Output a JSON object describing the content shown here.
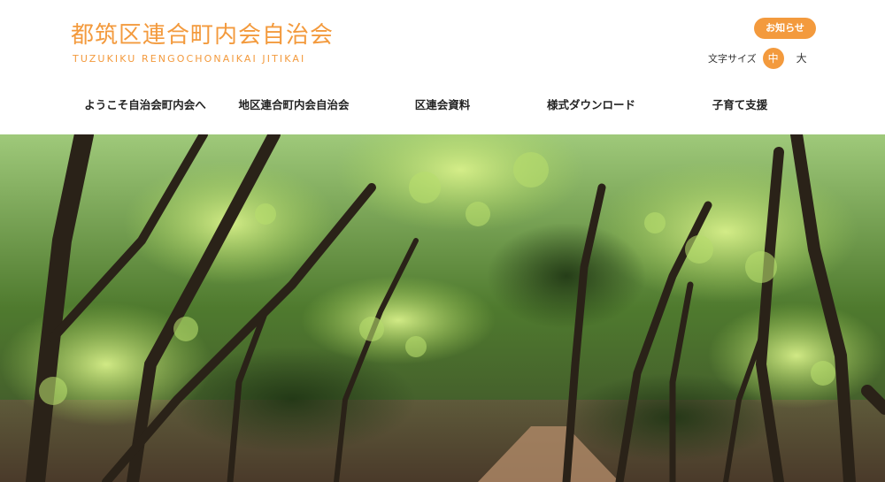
{
  "site": {
    "title_jp": "都筑区連合町内会自治会",
    "title_en": "TUZUKIKU RENGOCHONAIKAI JITIKAI"
  },
  "notice_button": "お知らせ",
  "font_size": {
    "label": "文字サイズ",
    "options": [
      "中",
      "大"
    ],
    "selected": "中"
  },
  "nav": {
    "items": [
      "ようこそ自治会町内会へ",
      "地区連合町内会自治会",
      "区連会資料",
      "様式ダウンロード",
      "子育て支援"
    ]
  },
  "colors": {
    "accent": "#f39a3d",
    "text": "#222222"
  },
  "hero": {
    "description_icon": "forest-photo"
  }
}
